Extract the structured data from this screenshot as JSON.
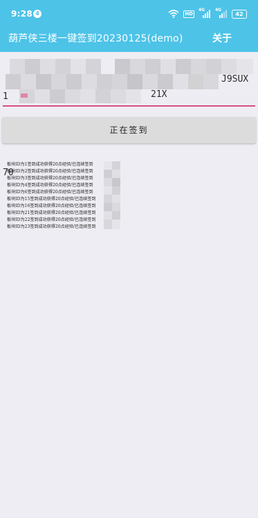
{
  "status_bar": {
    "time": "9:28",
    "notification_count": "4",
    "hd_label": "HD",
    "signal_label_1": "4G",
    "signal_label_2": "4G",
    "battery": "42"
  },
  "app_bar": {
    "title": "葫芦侠三楼一键签到20230125(demo)",
    "about_label": "关于"
  },
  "input": {
    "line_1": "1",
    "line_2": "",
    "line_3": "70",
    "line_1_end": "",
    "line_2_end": "J9SUX",
    "line_3_end": "21X"
  },
  "sign_button": {
    "label": "正在签到"
  },
  "log": {
    "lines": [
      "板块ID为1签到成功获得20点经验/已连续签到",
      "板块ID为2签到成功获得20点经验/已连续签到",
      "板块ID为3签到成功获得20点经验/已连续签到",
      "板块ID为4签到成功获得20点经验/已连续签到",
      "板块ID为6签到成功获得20点经验/已连续签到",
      "板块ID为15签到成功获得20点经验/已连续签到",
      "板块ID为16签到成功获得20点经验/已连续签到",
      "板块ID为21签到成功获得20点经验/已连续签到",
      "板块ID为22签到成功获得20点经验/已连续签到",
      "板块ID为23签到成功获得20点经验/已连续签到"
    ]
  },
  "colors": {
    "header": "#4dc3e8",
    "background": "#eeedf3",
    "accent_underline": "#d94e80",
    "button": "#dcdcdc"
  }
}
